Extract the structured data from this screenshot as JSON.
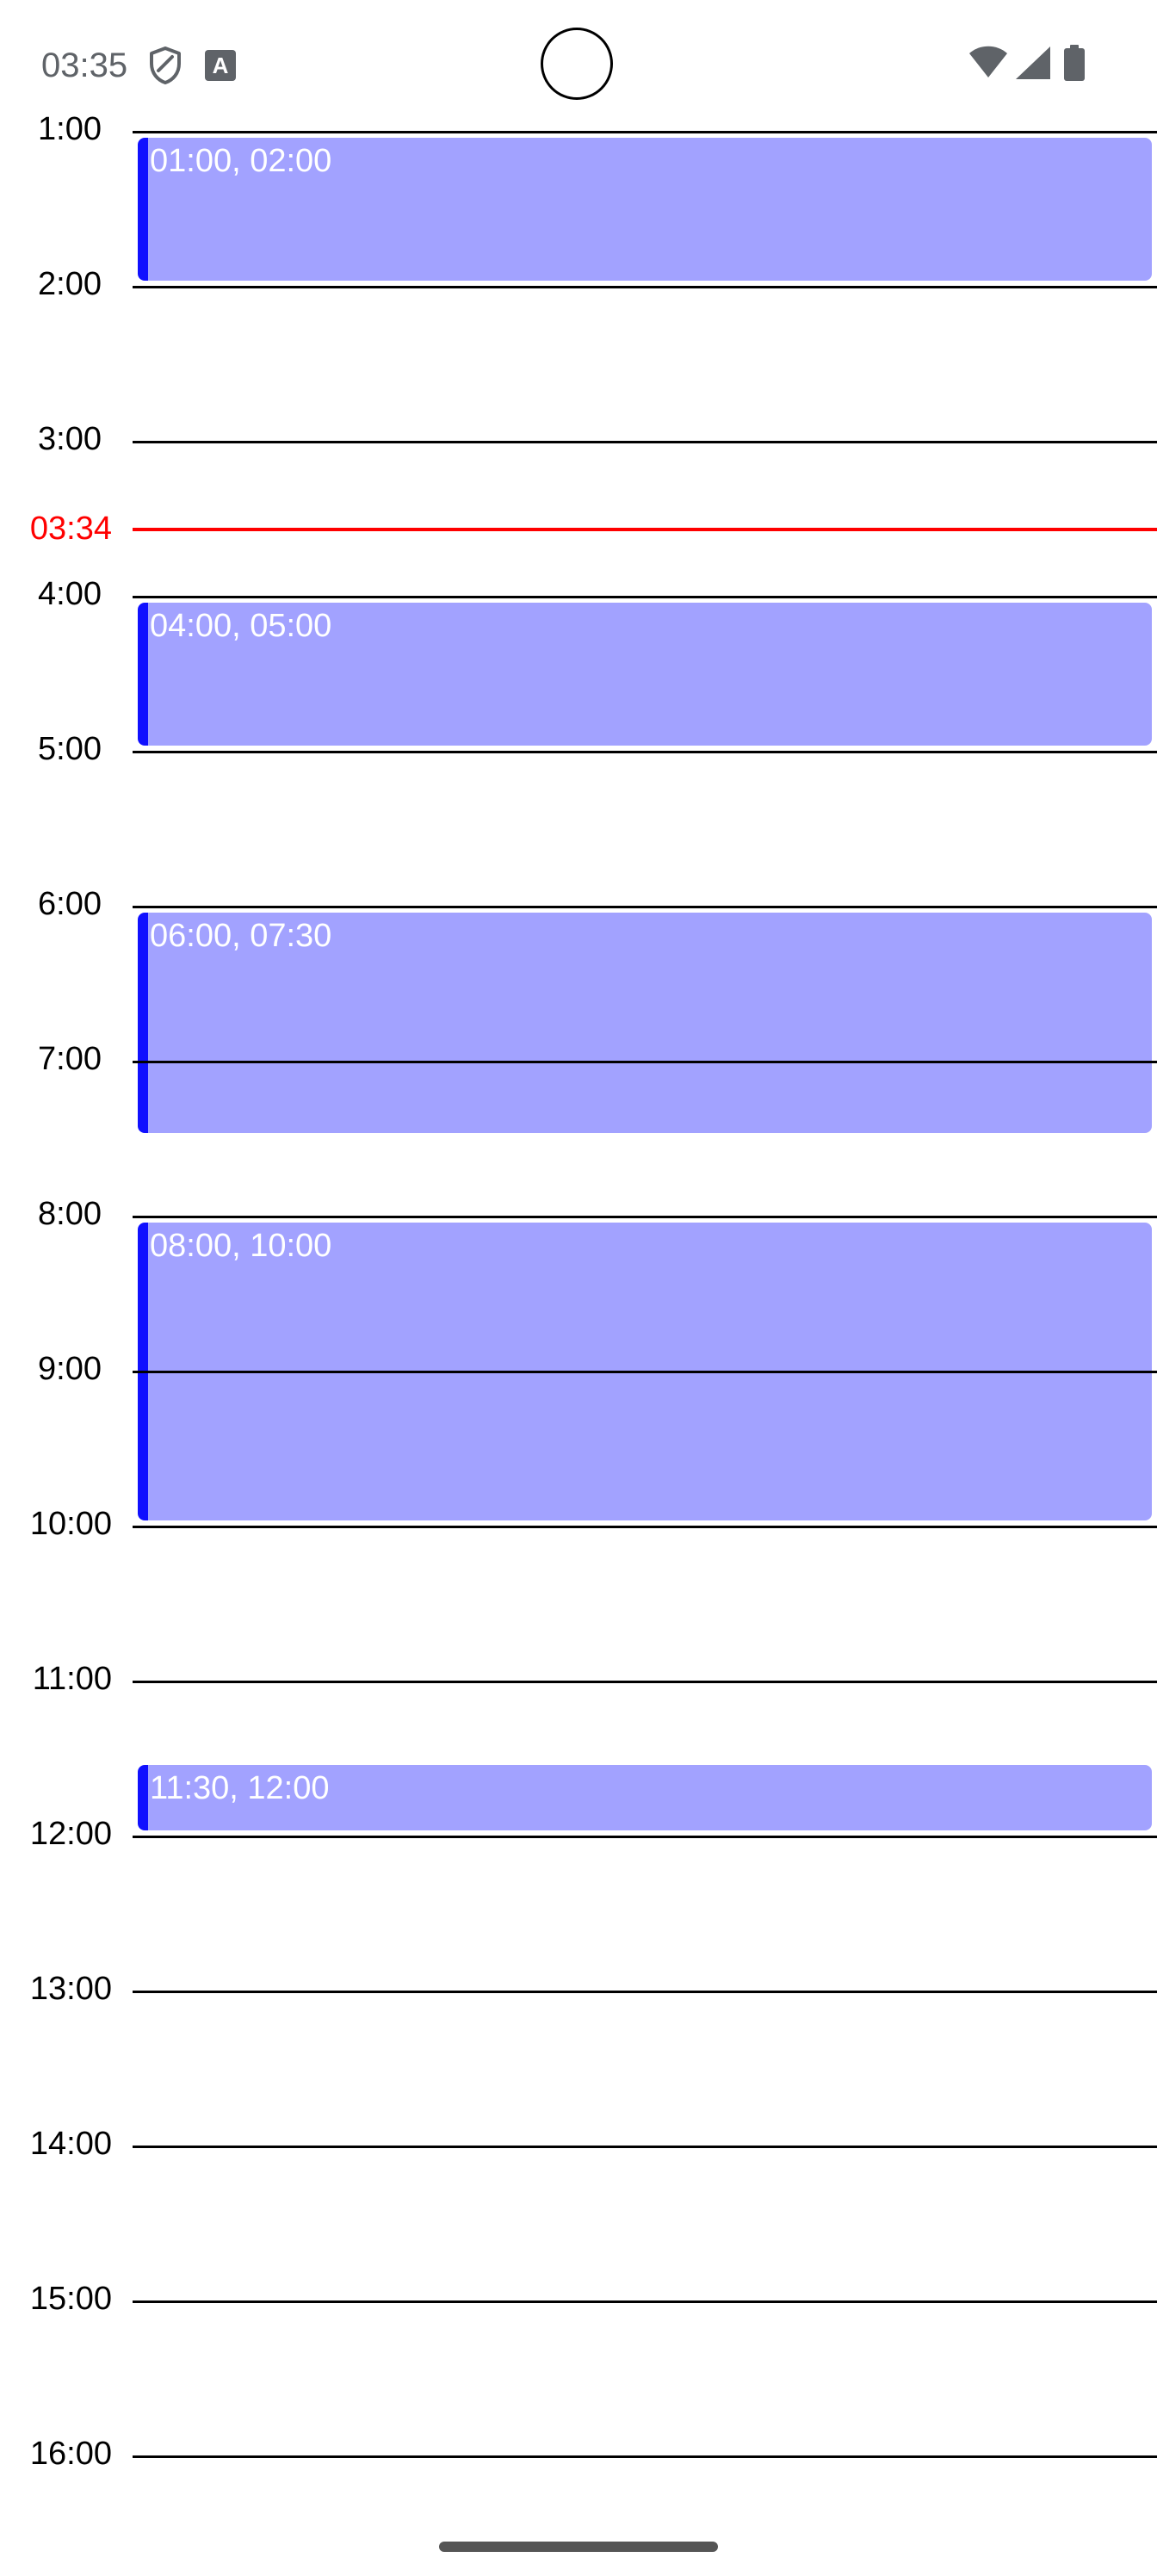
{
  "status_bar": {
    "time": "03:35",
    "icons": [
      "shield-icon",
      "keyboard-icon",
      "wifi-icon",
      "signal-icon",
      "battery-icon"
    ],
    "keyboard_glyph": "A"
  },
  "calendar": {
    "hours": [
      "1:00",
      "2:00",
      "3:00",
      "4:00",
      "5:00",
      "6:00",
      "7:00",
      "8:00",
      "9:00",
      "10:00",
      "11:00",
      "12:00",
      "13:00",
      "14:00",
      "15:00",
      "16:00"
    ],
    "first_hour": 1,
    "now_indicator": {
      "label": "03:34",
      "time_hours": 3.5667,
      "color": "#ff0000"
    },
    "events": [
      {
        "title": "01:00, 02:00",
        "start": 1.0,
        "end": 2.0
      },
      {
        "title": "04:00, 05:00",
        "start": 4.0,
        "end": 5.0
      },
      {
        "title": "06:00, 07:30",
        "start": 6.0,
        "end": 7.5
      },
      {
        "title": "08:00, 10:00",
        "start": 8.0,
        "end": 10.0
      },
      {
        "title": "11:30, 12:00",
        "start": 11.5,
        "end": 12.0
      }
    ],
    "colors": {
      "event_fill": "#a2a2ff",
      "event_accent": "#1010ff",
      "event_text": "#ffffff",
      "grid_line": "#000000"
    }
  }
}
